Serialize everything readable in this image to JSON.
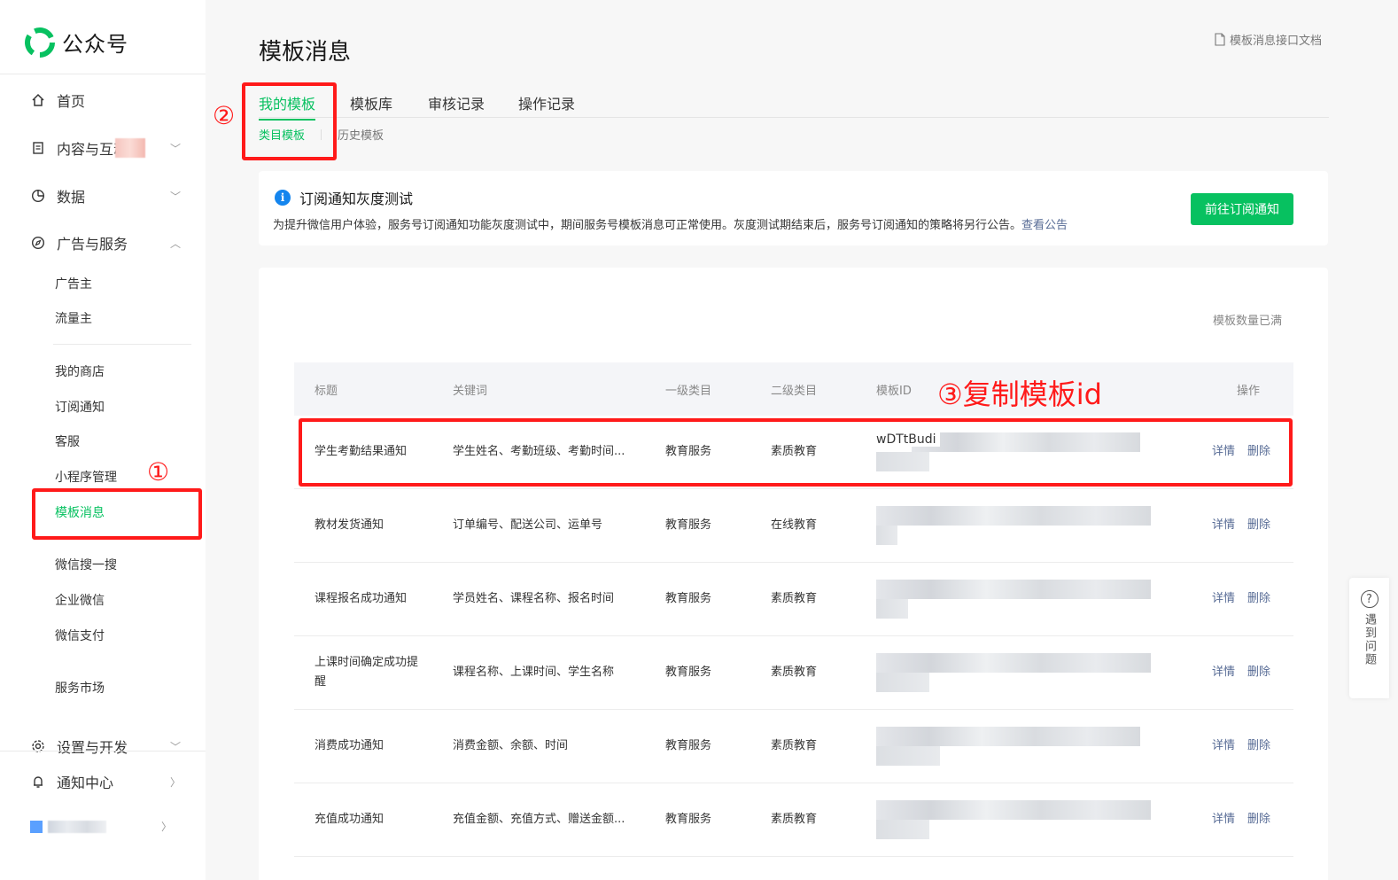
{
  "sidebar": {
    "logo_text": "公众号",
    "nav": {
      "home": "首页",
      "content": "内容与互动",
      "data": "数据",
      "ads": "广告与服务",
      "settings": "设置与开发",
      "notify": "通知中心"
    },
    "sub_items": {
      "advertiser": "广告主",
      "traffic": "流量主",
      "shop": "我的商店",
      "subscribe": "订阅通知",
      "service": "客服",
      "miniprogram": "小程序管理",
      "template": "模板消息",
      "search": "微信搜一搜",
      "wecom": "企业微信",
      "pay": "微信支付",
      "market": "服务市场"
    }
  },
  "header": {
    "title": "模板消息",
    "doc_link": "模板消息接口文档"
  },
  "tabs": [
    "我的模板",
    "模板库",
    "审核记录",
    "操作记录"
  ],
  "subtabs": [
    "类目模板",
    "历史模板"
  ],
  "notice": {
    "title": "订阅通知灰度测试",
    "desc": "为提升微信用户体验，服务号订阅通知功能灰度测试中，期间服务号模板消息可正常使用。灰度测试期结束后，服务号订阅通知的策略将另行公告。",
    "link": "查看公告",
    "button": "前往订阅通知"
  },
  "table": {
    "count_note": "模板数量已满",
    "headers": [
      "标题",
      "关键词",
      "一级类目",
      "二级类目",
      "模板ID",
      "操作"
    ],
    "rows": [
      {
        "title": "学生考勤结果通知",
        "keywords": "学生姓名、考勤班级、考勤时间...",
        "cat1": "教育服务",
        "cat2": "素质教育",
        "id_prefix": "wDTtBudi"
      },
      {
        "title": "教材发货通知",
        "keywords": "订单编号、配送公司、运单号",
        "cat1": "教育服务",
        "cat2": "在线教育",
        "id_prefix": ""
      },
      {
        "title": "课程报名成功通知",
        "keywords": "学员姓名、课程名称、报名时间",
        "cat1": "教育服务",
        "cat2": "素质教育",
        "id_prefix": ""
      },
      {
        "title": "上课时间确定成功提醒",
        "keywords": "课程名称、上课时间、学生名称",
        "cat1": "教育服务",
        "cat2": "素质教育",
        "id_prefix": ""
      },
      {
        "title": "消费成功通知",
        "keywords": "消费金额、余额、时间",
        "cat1": "教育服务",
        "cat2": "素质教育",
        "id_prefix": ""
      },
      {
        "title": "充值成功通知",
        "keywords": "充值金额、充值方式、赠送金额...",
        "cat1": "教育服务",
        "cat2": "素质教育",
        "id_prefix": ""
      }
    ],
    "op_detail": "详情",
    "op_delete": "删除"
  },
  "annotations": {
    "n1": "①",
    "n2": "②",
    "n3": "③复制模板id"
  },
  "help": {
    "label": "遇到问题"
  },
  "colors": {
    "brand": "#07c160",
    "link": "#576b95",
    "annotation": "#ff1a1a",
    "info": "#1485ee"
  }
}
